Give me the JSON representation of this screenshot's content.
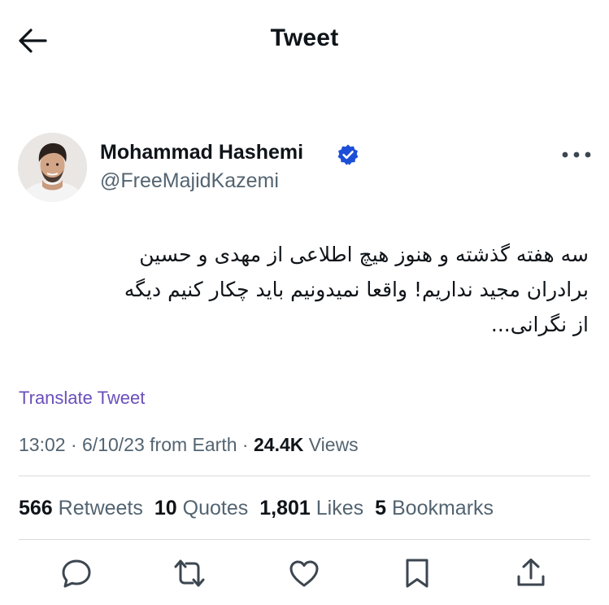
{
  "header": {
    "title": "Tweet"
  },
  "icons": {
    "back": "arrow-left-icon",
    "verified": "verified-badge-icon",
    "more": "more-icon",
    "reply": "reply-icon",
    "retweet": "retweet-icon",
    "like": "heart-icon",
    "bookmark": "bookmark-icon",
    "share": "share-icon"
  },
  "colors": {
    "link": "#6b4fbb",
    "verified": "#1d4ed8",
    "muted": "#536471"
  },
  "author": {
    "name": "Mohammad Hashemi",
    "handle": "@FreeMajidKazemi"
  },
  "tweet": {
    "lines": [
      "سه هفته گذشته و هنوز هیچ اطلاعی از مهدی و حسین",
      "برادران مجید نداریم! واقعا نمیدونیم باید چکار کنیم دیگه",
      "از نگرانی..."
    ],
    "translate": "Translate Tweet"
  },
  "meta": {
    "time": "13:02",
    "sep1": " · ",
    "date": "6/10/23",
    "source": " from Earth",
    "sep2": " · ",
    "views_count": "24.4K",
    "views_label": " Views"
  },
  "stats": [
    {
      "count": "566",
      "label": " Retweets"
    },
    {
      "count": "10",
      "label": " Quotes"
    },
    {
      "count": "1,801",
      "label": " Likes"
    },
    {
      "count": "5",
      "label": " Bookmarks"
    }
  ]
}
